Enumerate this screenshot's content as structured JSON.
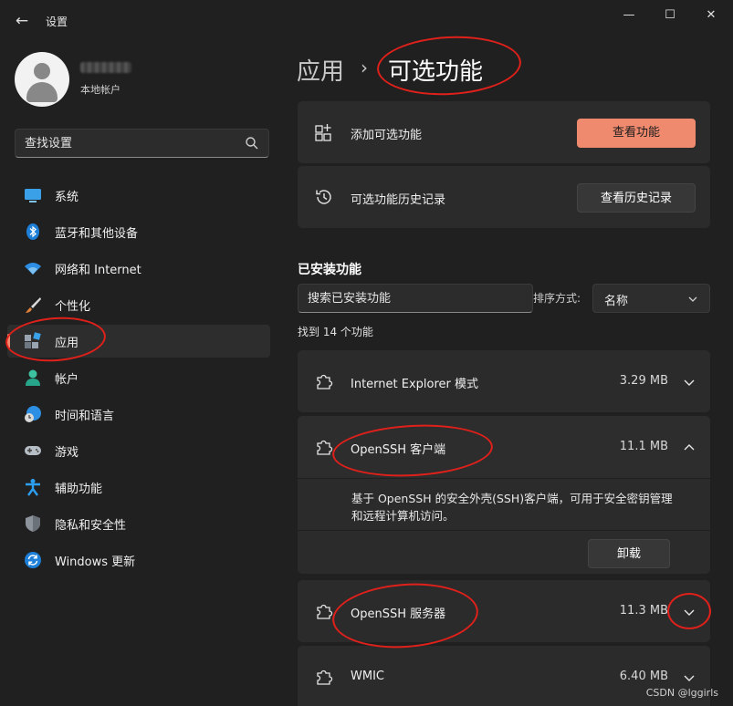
{
  "window": {
    "title": "设置",
    "back_glyph": "←",
    "minimize_glyph": "—",
    "maximize_glyph": "☐",
    "close_glyph": "✕"
  },
  "account": {
    "type": "本地帐户"
  },
  "sidebar": {
    "search_placeholder": "查找设置",
    "items": [
      {
        "label": "系统",
        "icon": "monitor-icon"
      },
      {
        "label": "蓝牙和其他设备",
        "icon": "bluetooth-icon"
      },
      {
        "label": "网络和 Internet",
        "icon": "wifi-icon"
      },
      {
        "label": "个性化",
        "icon": "brush-icon"
      },
      {
        "label": "应用",
        "icon": "apps-icon",
        "active": true
      },
      {
        "label": "帐户",
        "icon": "person-icon"
      },
      {
        "label": "时间和语言",
        "icon": "globe-clock-icon"
      },
      {
        "label": "游戏",
        "icon": "gamepad-icon"
      },
      {
        "label": "辅助功能",
        "icon": "accessibility-icon"
      },
      {
        "label": "隐私和安全性",
        "icon": "shield-icon"
      },
      {
        "label": "Windows 更新",
        "icon": "update-icon"
      }
    ]
  },
  "breadcrumb": {
    "parent": "应用",
    "separator": "›",
    "current": "可选功能"
  },
  "actions": {
    "add_label": "添加可选功能",
    "add_button": "查看功能",
    "history_label": "可选功能历史记录",
    "history_button": "查看历史记录"
  },
  "installed": {
    "title": "已安装功能",
    "search_placeholder": "搜索已安装功能",
    "sort_label": "排序方式:",
    "sort_value": "名称",
    "count_text": "找到 14 个功能",
    "features": [
      {
        "name": "Internet Explorer 模式",
        "size": "3.29 MB",
        "expanded": false
      },
      {
        "name": "OpenSSH 客户端",
        "size": "11.1 MB",
        "expanded": true,
        "description": "基于 OpenSSH 的安全外壳(SSH)客户端，可用于安全密钥管理和远程计算机访问。",
        "uninstall_label": "卸载"
      },
      {
        "name": "OpenSSH 服务器",
        "size": "11.3 MB",
        "expanded": false
      },
      {
        "name": "WMIC",
        "size": "6.40 MB",
        "expanded": false
      }
    ]
  },
  "watermark": "CSDN @lggirls",
  "colors": {
    "background": "#202020",
    "card": "#2b2b2b",
    "accent": "#f08a6e",
    "annotation": "#e0201a"
  }
}
